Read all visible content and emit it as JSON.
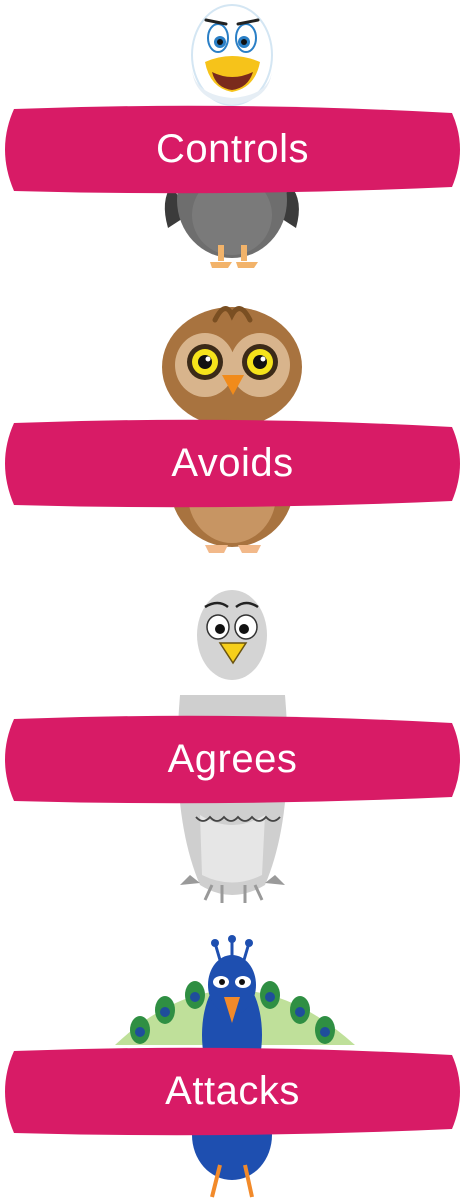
{
  "accent_color": "#d81b66",
  "cards": [
    {
      "label": "Controls",
      "icon": "eagle-icon"
    },
    {
      "label": "Avoids",
      "icon": "owl-icon"
    },
    {
      "label": "Agrees",
      "icon": "dove-icon"
    },
    {
      "label": "Attacks",
      "icon": "peacock-icon"
    }
  ]
}
